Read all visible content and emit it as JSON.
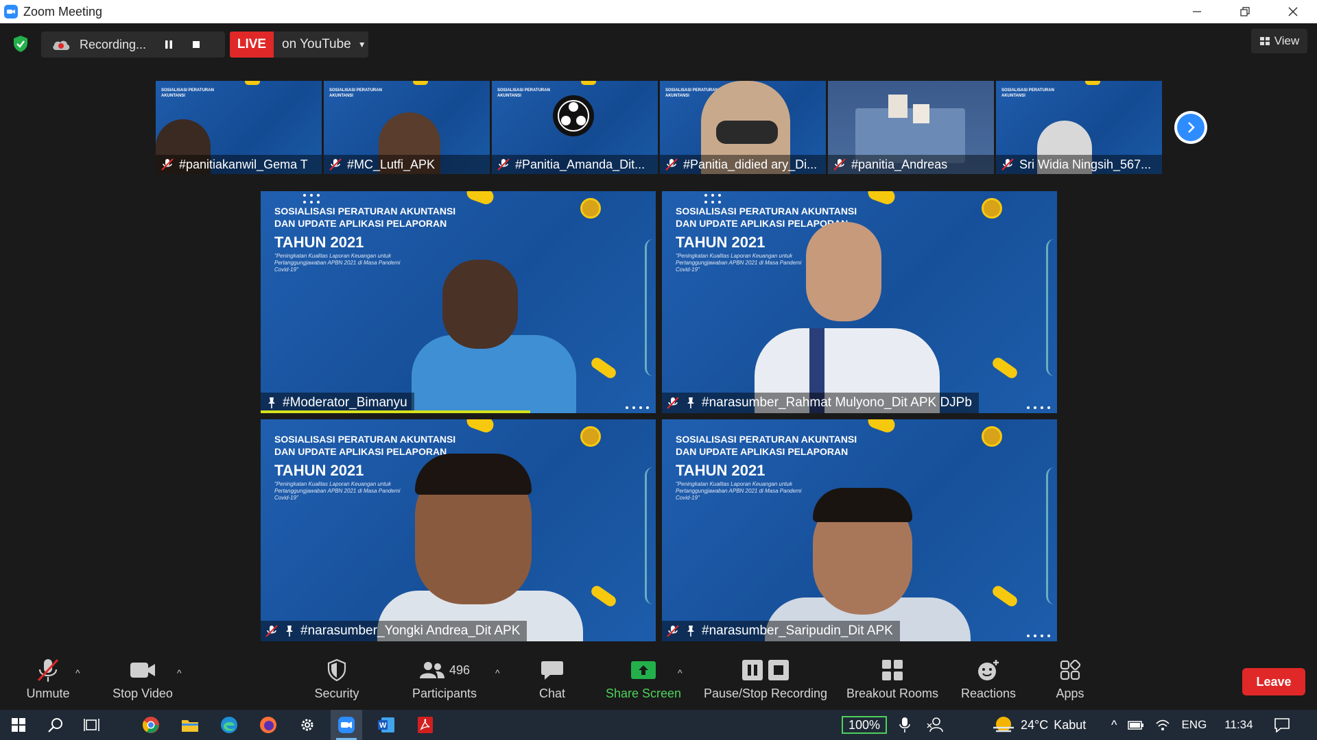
{
  "window": {
    "title": "Zoom Meeting"
  },
  "top": {
    "recording_label": "Recording...",
    "live_label": "LIVE",
    "stream_target": "on YouTube",
    "view_label": "View"
  },
  "slide": {
    "line1": "SOSIALISASI PERATURAN AKUNTANSI",
    "line2": "DAN UPDATE APLIKASI PELAPORAN",
    "year": "TAHUN 2021",
    "subtitle": "\"Peningkatan Kualitas Laporan Keuangan untuk Pertanggungjawaban APBN 2021 di Masa Pandemi Covid-19\""
  },
  "thumbnails": [
    {
      "name": "#panitiakanwil_Gema T"
    },
    {
      "name": "#MC_Lutfi_APK"
    },
    {
      "name": "#Panitia_Amanda_Dit..."
    },
    {
      "name": "#Panitia_didied ary_Di..."
    },
    {
      "name": "#panitia_Andreas"
    },
    {
      "name": "Sri Widia Ningsih_567..."
    }
  ],
  "tiles": [
    {
      "name": "#Moderator_Bimanyu"
    },
    {
      "name": "#narasumber_Rahmat Mulyono_Dit APK DJPb"
    },
    {
      "name": "#narasumber_Yongki Andrea_Dit APK"
    },
    {
      "name": "#narasumber_Saripudin_Dit APK"
    }
  ],
  "toolbar": {
    "unmute": "Unmute",
    "stop_video": "Stop Video",
    "security": "Security",
    "participants": "Participants",
    "participants_count": "496",
    "chat": "Chat",
    "share_screen": "Share Screen",
    "pause_stop_recording": "Pause/Stop Recording",
    "breakout_rooms": "Breakout Rooms",
    "reactions": "Reactions",
    "apps": "Apps",
    "leave": "Leave"
  },
  "taskbar": {
    "zoom_level": "100%",
    "weather_temp": "24°C",
    "weather_desc": "Kabut",
    "language": "ENG",
    "clock": "11:34"
  },
  "colors": {
    "accent_blue": "#2d8cff",
    "live_red": "#e02828",
    "share_green": "#4fd15c",
    "slide_blue": "#1a56a3",
    "slide_yellow": "#f6c90e"
  }
}
